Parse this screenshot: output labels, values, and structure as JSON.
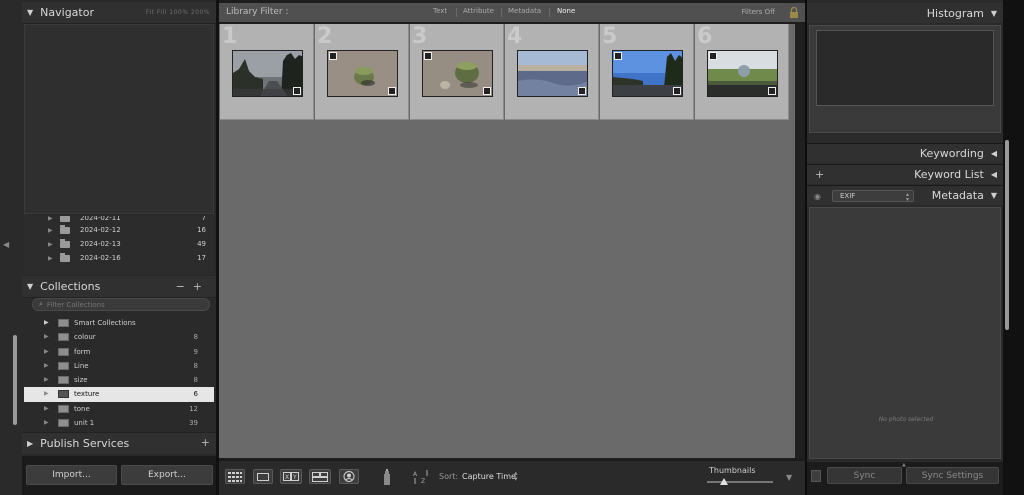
{
  "left_panel": {
    "navigator": {
      "title": "Navigator",
      "options": "Fit   Fill   100%   200%"
    },
    "folders": [
      {
        "name": "2024-02-11",
        "count": "7"
      },
      {
        "name": "2024-02-12",
        "count": "16"
      },
      {
        "name": "2024-02-13",
        "count": "49"
      },
      {
        "name": "2024-02-16",
        "count": "17"
      }
    ],
    "collections": {
      "title": "Collections",
      "filter_placeholder": "Filter Collections",
      "smart_collections_label": "Smart Collections",
      "items": [
        {
          "name": "colour",
          "count": "8"
        },
        {
          "name": "form",
          "count": "9"
        },
        {
          "name": "Line",
          "count": "8"
        },
        {
          "name": "size",
          "count": "8"
        },
        {
          "name": "texture",
          "count": "6",
          "selected": true
        },
        {
          "name": "tone",
          "count": "12"
        },
        {
          "name": "unit 1",
          "count": "39"
        }
      ]
    },
    "publish_services": {
      "title": "Publish Services"
    },
    "import_label": "Import...",
    "export_label": "Export..."
  },
  "center": {
    "filter_bar": {
      "label": "Library Filter :",
      "options": [
        "Text",
        "Attribute",
        "Metadata",
        "None"
      ],
      "active": "None",
      "filters_off": "Filters Off"
    },
    "grid": {
      "cells": [
        {
          "index": "1",
          "scene": "forest-road"
        },
        {
          "index": "2",
          "scene": "bowl-rock"
        },
        {
          "index": "3",
          "scene": "bowl-rocks"
        },
        {
          "index": "4",
          "scene": "beach"
        },
        {
          "index": "5",
          "scene": "street-trees"
        },
        {
          "index": "6",
          "scene": "park-sculpture"
        }
      ]
    },
    "toolbar": {
      "sort_label": "Sort:",
      "sort_value": "Capture Time",
      "thumbnails_label": "Thumbnails",
      "thumbnail_size": 0.25
    }
  },
  "right_panel": {
    "histogram": {
      "title": "Histogram"
    },
    "keywording": {
      "title": "Keywording"
    },
    "keyword_list": {
      "title": "Keyword List"
    },
    "metadata": {
      "title": "Metadata",
      "preset": "EXIF",
      "empty_text": "No photo selected"
    },
    "sync_label": "Sync",
    "sync_settings_label": "Sync Settings"
  }
}
